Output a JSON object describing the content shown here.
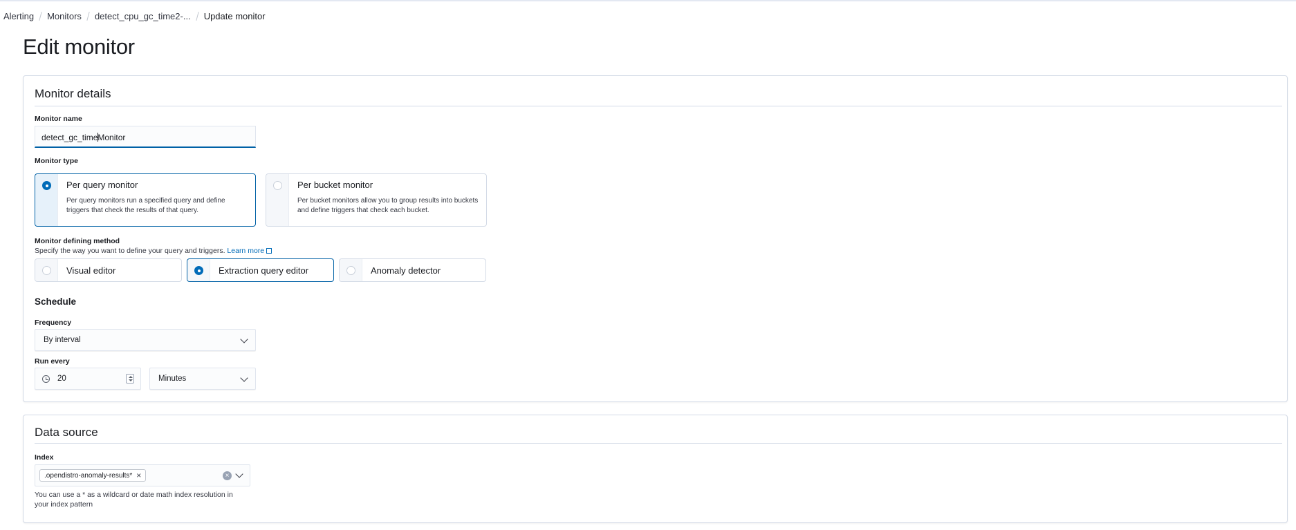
{
  "breadcrumbs": [
    "Alerting",
    "Monitors",
    "detect_cpu_gc_time2-...",
    "Update monitor"
  ],
  "page_title": "Edit monitor",
  "details": {
    "title": "Monitor details",
    "monitor_name": {
      "label": "Monitor name",
      "value_before_caret": "detect_gc_time",
      "value_after_caret": "Monitor",
      "caret_char": "-"
    },
    "monitor_type": {
      "label": "Monitor type",
      "options": [
        {
          "title": "Per query monitor",
          "desc": "Per query monitors run a specified query and define triggers that check the results of that query.",
          "selected": true
        },
        {
          "title": "Per bucket monitor",
          "desc": "Per bucket monitors allow you to group results into buckets and define triggers that check each bucket.",
          "selected": false
        }
      ]
    },
    "defining_method": {
      "label": "Monitor defining method",
      "help": "Specify the way you want to define your query and triggers.",
      "learn_more": "Learn more",
      "options": [
        {
          "label": "Visual editor",
          "selected": false
        },
        {
          "label": "Extraction query editor",
          "selected": true
        },
        {
          "label": "Anomaly detector",
          "selected": false
        }
      ]
    },
    "schedule": {
      "title": "Schedule",
      "frequency_label": "Frequency",
      "frequency_value": "By interval",
      "run_every_label": "Run every",
      "run_every_value": "20",
      "run_every_unit": "Minutes"
    }
  },
  "datasource": {
    "title": "Data source",
    "index_label": "Index",
    "index_values": [
      ".opendistro-anomaly-results*"
    ],
    "help": "You can use a * as a wildcard or date math index resolution in your index pattern"
  },
  "colors": {
    "primary": "#006bb8",
    "border": "#d3dae6",
    "text": "#1a1c21"
  },
  "icons": [
    "clock-icon",
    "chevron-down-icon",
    "close-icon",
    "clear-icon",
    "external-link-icon"
  ]
}
